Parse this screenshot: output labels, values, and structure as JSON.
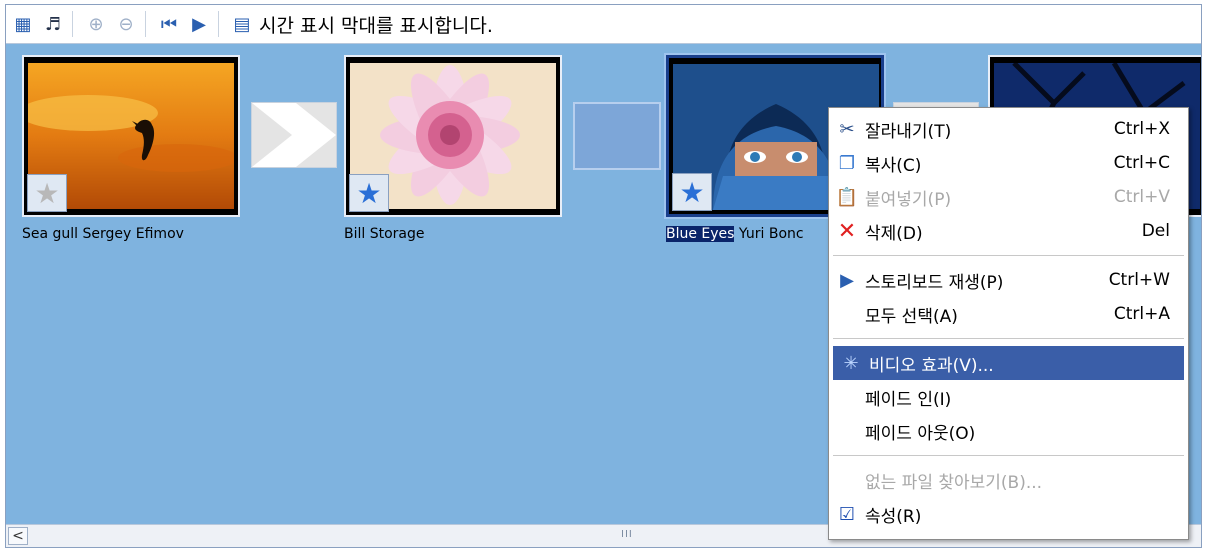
{
  "toolbar": {
    "icons": [
      "storyboard-icon",
      "audio-levels-icon",
      "zoom-in-icon",
      "zoom-out-icon",
      "rewind-icon",
      "play-icon",
      "timeline-icon"
    ],
    "timeline_label": "시간 표시 막대를 표시합니다."
  },
  "clips": [
    {
      "caption": "Sea gull Sergey Efimov"
    },
    {
      "caption": "Bill Storage"
    },
    {
      "caption_highlight": "Blue Eyes",
      "caption_rest": " Yuri Bonc"
    }
  ],
  "context_menu": {
    "items": [
      {
        "label": "잘라내기(T)",
        "shortcut": "Ctrl+X"
      },
      {
        "label": "복사(C)",
        "shortcut": "Ctrl+C"
      },
      {
        "label": "붙여넣기(P)",
        "shortcut": "Ctrl+V"
      },
      {
        "label": "삭제(D)",
        "shortcut": "Del"
      },
      {
        "label": "스토리보드 재생(P)",
        "shortcut": "Ctrl+W"
      },
      {
        "label": "모두 선택(A)",
        "shortcut": "Ctrl+A"
      },
      {
        "label": "비디오 효과(V)..."
      },
      {
        "label": "페이드 인(I)"
      },
      {
        "label": "페이드 아웃(O)"
      },
      {
        "label": "없는 파일 찾아보기(B)..."
      },
      {
        "label": "속성(R)"
      }
    ]
  },
  "scrollbar": {
    "left_arrow": "<",
    "grip": "III"
  },
  "colors": {
    "storyboard_bg": "#7fb3df",
    "menu_highlight": "#3a5ea8",
    "selection": "#0a246a"
  }
}
